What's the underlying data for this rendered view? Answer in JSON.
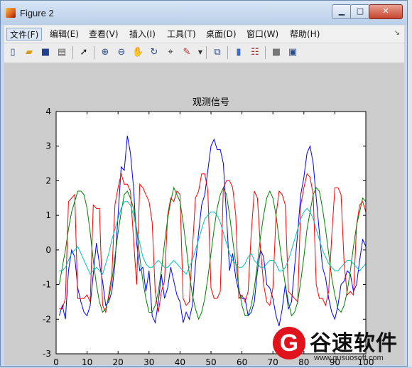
{
  "window": {
    "title": "Figure 2",
    "min_label": "▁",
    "max_label": "□",
    "close_label": "✕"
  },
  "menu": {
    "items": [
      "文件(F)",
      "编辑(E)",
      "查看(V)",
      "插入(I)",
      "工具(T)",
      "桌面(D)",
      "窗口(W)",
      "帮助(H)"
    ],
    "pin": "↘"
  },
  "toolbar": {
    "icons": [
      "new-figure-icon",
      "open-icon",
      "save-icon",
      "print-icon",
      "pointer-icon",
      "zoom-in-icon",
      "zoom-out-icon",
      "pan-icon",
      "rotate-icon",
      "data-cursor-icon",
      "brush-icon",
      "link-icon",
      "colorbar-icon",
      "legend-icon",
      "hide-plot-tools-icon",
      "show-plot-tools-icon"
    ]
  },
  "watermark": {
    "logo_letter": "G",
    "name": "谷速软件",
    "url": "www.gusuosoft.com"
  },
  "chart_data": {
    "type": "line",
    "title": "观测信号",
    "xlabel": "",
    "ylabel": "",
    "xlim": [
      0,
      100
    ],
    "ylim": [
      -3,
      4
    ],
    "xticks": [
      0,
      10,
      20,
      30,
      40,
      50,
      60,
      70,
      80,
      90,
      100
    ],
    "yticks": [
      -3,
      -2,
      -1,
      0,
      1,
      2,
      3,
      4
    ],
    "grid": false,
    "series": [
      {
        "color": "#0000ff",
        "x": [
          1,
          2,
          3,
          4,
          5,
          6,
          7,
          8,
          9,
          10,
          11,
          12,
          13,
          14,
          15,
          16,
          17,
          18,
          19,
          20,
          21,
          22,
          23,
          24,
          25,
          26,
          27,
          28,
          29,
          30,
          31,
          32,
          33,
          34,
          35,
          36,
          37,
          38,
          39,
          40,
          41,
          42,
          43,
          44,
          45,
          46,
          47,
          48,
          49,
          50,
          51,
          52,
          53,
          54,
          55,
          56,
          57,
          58,
          59,
          60,
          61,
          62,
          63,
          64,
          65,
          66,
          67,
          68,
          69,
          70,
          71,
          72,
          73,
          74,
          75,
          76,
          77,
          78,
          79,
          80,
          81,
          82,
          83,
          84,
          85,
          86,
          87,
          88,
          89,
          90,
          91,
          92,
          93,
          94,
          95,
          96,
          97,
          98,
          99,
          100
        ],
        "y": [
          -1.9,
          -1.6,
          -2.0,
          -0.6,
          0.0,
          -0.2,
          -1.1,
          -1.5,
          -1.8,
          -1.9,
          -1.6,
          -0.7,
          0.2,
          -0.4,
          -0.9,
          -1.6,
          -1.5,
          -1.2,
          -0.4,
          1.0,
          2.4,
          2.3,
          3.3,
          2.8,
          1.8,
          0.2,
          -0.6,
          -0.5,
          -1.2,
          -0.6,
          -1.9,
          -2.1,
          -1.5,
          -0.7,
          -1.4,
          -1.1,
          -0.5,
          -0.9,
          -1.3,
          -1.5,
          -2.1,
          -1.8,
          -2.0,
          -1.6,
          -0.4,
          0.5,
          1.3,
          1.6,
          2.3,
          3.0,
          3.2,
          2.9,
          2.9,
          2.5,
          1.0,
          -0.6,
          -0.1,
          -0.8,
          -1.2,
          -1.4,
          -1.4,
          -1.9,
          -1.8,
          -1.5,
          -0.6,
          0.0,
          -0.2,
          -1.0,
          -1.1,
          -1.4,
          -1.9,
          -2.2,
          -1.7,
          -1.0,
          -1.7,
          -1.5,
          -0.5,
          0.5,
          1.6,
          2.1,
          2.8,
          3.0,
          2.5,
          1.5,
          0.5,
          -0.5,
          -0.8,
          -1.4,
          -1.8,
          -2.0,
          -1.6,
          -1.0,
          -0.9,
          -0.6,
          -0.7,
          -1.2,
          -1.0,
          -0.3,
          0.3,
          0.1
        ]
      },
      {
        "color": "#ff0000",
        "x": [
          1,
          2,
          3,
          4,
          5,
          6,
          7,
          8,
          9,
          10,
          11,
          12,
          13,
          14,
          15,
          16,
          17,
          18,
          19,
          20,
          21,
          22,
          23,
          24,
          25,
          26,
          27,
          28,
          29,
          30,
          31,
          32,
          33,
          34,
          35,
          36,
          37,
          38,
          39,
          40,
          41,
          42,
          43,
          44,
          45,
          46,
          47,
          48,
          49,
          50,
          51,
          52,
          53,
          54,
          55,
          56,
          57,
          58,
          59,
          60,
          61,
          62,
          63,
          64,
          65,
          66,
          67,
          68,
          69,
          70,
          71,
          72,
          73,
          74,
          75,
          76,
          77,
          78,
          79,
          80,
          81,
          82,
          83,
          84,
          85,
          86,
          87,
          88,
          89,
          90,
          91,
          92,
          93,
          94,
          95,
          96,
          97,
          98,
          99,
          100
        ],
        "y": [
          -1.7,
          -1.7,
          -1.4,
          1.4,
          1.5,
          1.6,
          -1.4,
          -1.4,
          -1.4,
          -1.3,
          -1.5,
          1.3,
          1.2,
          1.2,
          -1.6,
          -1.8,
          -1.3,
          -0.7,
          1.3,
          1.8,
          2.2,
          1.9,
          1.9,
          1.7,
          0.3,
          -1.0,
          1.9,
          1.8,
          1.6,
          1.4,
          0.8,
          -1.2,
          -1.8,
          -1.2,
          -0.9,
          1.0,
          1.5,
          1.4,
          1.7,
          1.6,
          -1.4,
          -1.6,
          -1.5,
          0.0,
          1.5,
          1.7,
          2.2,
          2.2,
          1.7,
          -1.1,
          -1.4,
          -1.4,
          -1.2,
          1.8,
          2.0,
          2.0,
          1.8,
          1.0,
          -1.4,
          -1.3,
          -1.5,
          -1.2,
          0.5,
          1.7,
          1.5,
          0.0,
          -1.0,
          -1.5,
          -1.6,
          -1.1,
          1.0,
          1.7,
          1.6,
          1.3,
          -1.2,
          -1.3,
          -1.4,
          -1.5,
          1.3,
          1.8,
          2.2,
          2.1,
          1.6,
          -1.0,
          -1.4,
          -1.4,
          -1.6,
          -1.2,
          0.4,
          1.8,
          1.8,
          1.6,
          -0.4,
          -1.3,
          -1.2,
          -1.3,
          0.7,
          1.3,
          1.4,
          1.1
        ]
      },
      {
        "color": "#008000",
        "x": [
          1,
          2,
          3,
          4,
          5,
          6,
          7,
          8,
          9,
          10,
          11,
          12,
          13,
          14,
          15,
          16,
          17,
          18,
          19,
          20,
          21,
          22,
          23,
          24,
          25,
          26,
          27,
          28,
          29,
          30,
          31,
          32,
          33,
          34,
          35,
          36,
          37,
          38,
          39,
          40,
          41,
          42,
          43,
          44,
          45,
          46,
          47,
          48,
          49,
          50,
          51,
          52,
          53,
          54,
          55,
          56,
          57,
          58,
          59,
          60,
          61,
          62,
          63,
          64,
          65,
          66,
          67,
          68,
          69,
          70,
          71,
          72,
          73,
          74,
          75,
          76,
          77,
          78,
          79,
          80,
          81,
          82,
          83,
          84,
          85,
          86,
          87,
          88,
          89,
          90,
          91,
          92,
          93,
          94,
          95,
          96,
          97,
          98,
          99,
          100
        ],
        "y": [
          -1.0,
          -0.5,
          0.0,
          0.6,
          1.1,
          1.4,
          1.7,
          1.7,
          1.6,
          1.2,
          0.5,
          -0.3,
          -1.0,
          -1.5,
          -1.8,
          -1.7,
          -1.4,
          -0.9,
          -0.2,
          0.5,
          1.1,
          1.6,
          1.7,
          1.5,
          1.2,
          0.6,
          -0.2,
          -0.9,
          -1.4,
          -1.8,
          -1.8,
          -1.6,
          -1.2,
          -0.6,
          0.2,
          0.9,
          1.4,
          1.8,
          1.6,
          1.4,
          0.8,
          0.1,
          -0.7,
          -1.3,
          -1.7,
          -2.0,
          -1.8,
          -1.4,
          -0.8,
          -0.1,
          0.6,
          1.2,
          1.6,
          1.8,
          1.6,
          1.0,
          0.3,
          -0.4,
          -1.1,
          -1.6,
          -1.9,
          -1.9,
          -1.6,
          -1.1,
          -0.4,
          0.4,
          1.0,
          1.5,
          1.7,
          1.5,
          1.0,
          0.3,
          -0.4,
          -1.0,
          -1.5,
          -1.9,
          -1.8,
          -1.5,
          -0.9,
          -0.2,
          0.6,
          1.1,
          1.6,
          1.8,
          1.7,
          1.2,
          0.6,
          -0.1,
          -0.8,
          -1.3,
          -1.7,
          -1.8,
          -1.6,
          -1.2,
          -0.6,
          0.1,
          0.7,
          1.1,
          1.5,
          1.4
        ]
      },
      {
        "color": "#00bfbf",
        "x": [
          1,
          2,
          3,
          4,
          5,
          6,
          7,
          8,
          9,
          10,
          11,
          12,
          13,
          14,
          15,
          16,
          17,
          18,
          19,
          20,
          21,
          22,
          23,
          24,
          25,
          26,
          27,
          28,
          29,
          30,
          31,
          32,
          33,
          34,
          35,
          36,
          37,
          38,
          39,
          40,
          41,
          42,
          43,
          44,
          45,
          46,
          47,
          48,
          49,
          50,
          51,
          52,
          53,
          54,
          55,
          56,
          57,
          58,
          59,
          60,
          61,
          62,
          63,
          64,
          65,
          66,
          67,
          68,
          69,
          70,
          71,
          72,
          73,
          74,
          75,
          76,
          77,
          78,
          79,
          80,
          81,
          82,
          83,
          84,
          85,
          86,
          87,
          88,
          89,
          90,
          91,
          92,
          93,
          94,
          95,
          96,
          97,
          98,
          99,
          100
        ],
        "y": [
          -0.6,
          -0.6,
          -0.5,
          -0.3,
          -0.1,
          0.0,
          0.1,
          -0.1,
          -0.3,
          -0.5,
          -0.7,
          -0.6,
          -0.5,
          -0.6,
          -0.7,
          -0.4,
          -0.1,
          0.3,
          0.6,
          0.9,
          1.2,
          1.4,
          1.4,
          1.3,
          1.0,
          0.6,
          0.2,
          -0.2,
          -0.4,
          -0.5,
          -0.5,
          -0.4,
          -0.3,
          -0.4,
          -0.5,
          -0.5,
          -0.4,
          -0.3,
          -0.4,
          -0.5,
          -0.6,
          -0.7,
          -0.5,
          -0.3,
          0.0,
          0.3,
          0.6,
          0.9,
          1.0,
          1.1,
          1.1,
          1.0,
          0.8,
          0.5,
          0.2,
          -0.1,
          -0.3,
          -0.4,
          -0.5,
          -0.5,
          -0.4,
          -0.2,
          -0.1,
          -0.3,
          -0.4,
          -0.5,
          -0.5,
          -0.4,
          -0.3,
          -0.3,
          -0.4,
          -0.6,
          -0.6,
          -0.5,
          -0.3,
          0.0,
          0.3,
          0.6,
          0.9,
          1.1,
          1.2,
          1.1,
          0.9,
          0.6,
          0.3,
          0.0,
          -0.2,
          -0.4,
          -0.5,
          -0.6,
          -0.6,
          -0.5,
          -0.4,
          -0.3,
          -0.3,
          -0.4,
          -0.5,
          -0.6,
          -0.5,
          -0.4
        ]
      }
    ]
  }
}
